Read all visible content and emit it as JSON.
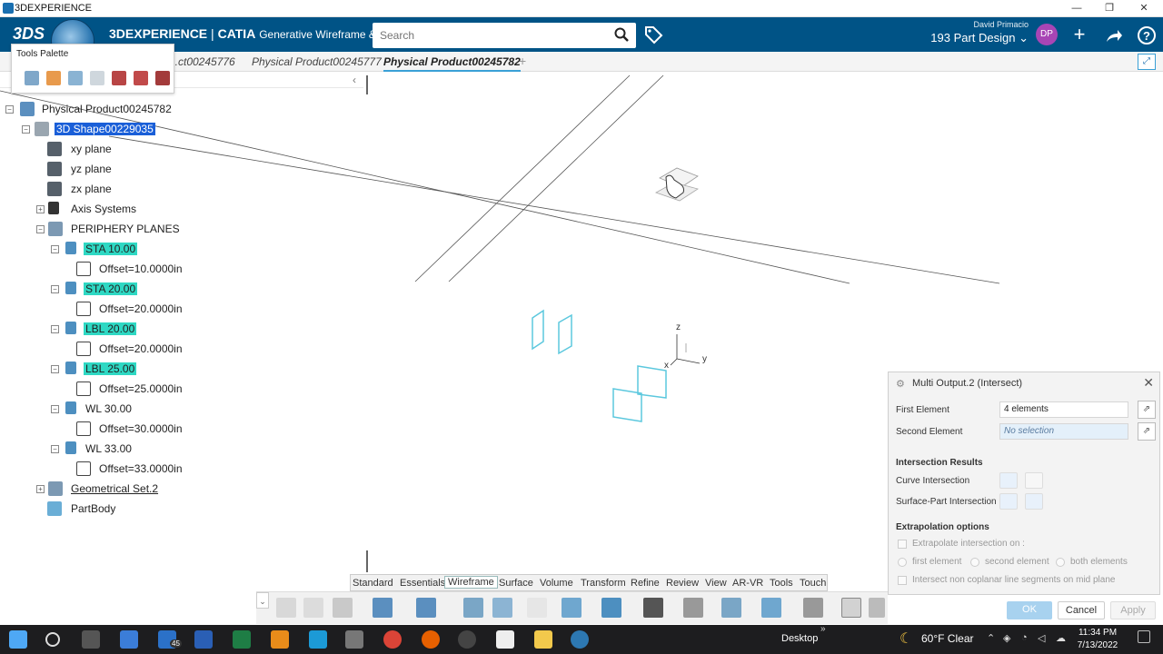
{
  "window": {
    "title": "3DEXPERIENCE",
    "controls": [
      "—",
      "❐",
      "✕"
    ]
  },
  "topbar": {
    "brand": "3DEXPERIENCE",
    "app": "CATIA",
    "subtitle": "Generative Wireframe & S...",
    "search_placeholder": "Search",
    "user_name": "David Primacio",
    "role": "193 Part Design ⌄",
    "avatar": "DP",
    "icons": [
      "plus-icon",
      "share-icon",
      "help-icon"
    ]
  },
  "tabs": {
    "items": [
      "...ct00245776",
      "Physical Product00245777",
      "Physical Product00245782"
    ],
    "active": "Physical Product00245782"
  },
  "palette": {
    "title": "Tools Palette"
  },
  "tree": {
    "root": "Physical Product00245782",
    "shape": "3D Shape00229035",
    "planes": [
      "xy plane",
      "yz plane",
      "zx plane"
    ],
    "axis": "Axis Systems",
    "periphery": "PERIPHERY PLANES",
    "items": [
      {
        "name": "STA 10.00",
        "offset": "Offset=10.0000in"
      },
      {
        "name": "STA 20.00",
        "offset": "Offset=20.0000in"
      },
      {
        "name": "LBL 20.00",
        "offset": "Offset=20.0000in"
      },
      {
        "name": "LBL 25.00",
        "offset": "Offset=25.0000in"
      },
      {
        "name": "WL 30.00",
        "offset": "Offset=30.0000in"
      },
      {
        "name": "WL 33.00",
        "offset": "Offset=33.0000in"
      }
    ],
    "geoset": "Geometrical Set.2",
    "partbody": "PartBody"
  },
  "axes": {
    "x": "x",
    "y": "y",
    "z": "z"
  },
  "panel": {
    "title": "Multi Output.2 (Intersect)",
    "first_label": "First Element",
    "first_value": "4 elements",
    "second_label": "Second Element",
    "second_value": "No selection",
    "results_title": "Intersection Results",
    "curve_label": "Curve Intersection",
    "surface_label": "Surface-Part Intersection",
    "extrap_title": "Extrapolation options",
    "extrap_check": "Extrapolate intersection on :",
    "opt1": "first element",
    "opt2": "second element",
    "opt3": "both elements",
    "noncoplanar": "Intersect non coplanar line segments on mid plane",
    "ok": "OK",
    "cancel": "Cancel",
    "apply": "Apply"
  },
  "bottom_tabs": [
    "Standard",
    "Essentials",
    "Wireframe",
    "Surface",
    "Volume",
    "Transform",
    "Refine",
    "Review",
    "View",
    "AR-VR",
    "Tools",
    "Touch"
  ],
  "bottom_active": "Wireframe",
  "taskbar": {
    "desktop": "Desktop",
    "weather": "60°F  Clear",
    "time": "11:34 PM",
    "date": "7/13/2022",
    "mail_badge": "45"
  }
}
